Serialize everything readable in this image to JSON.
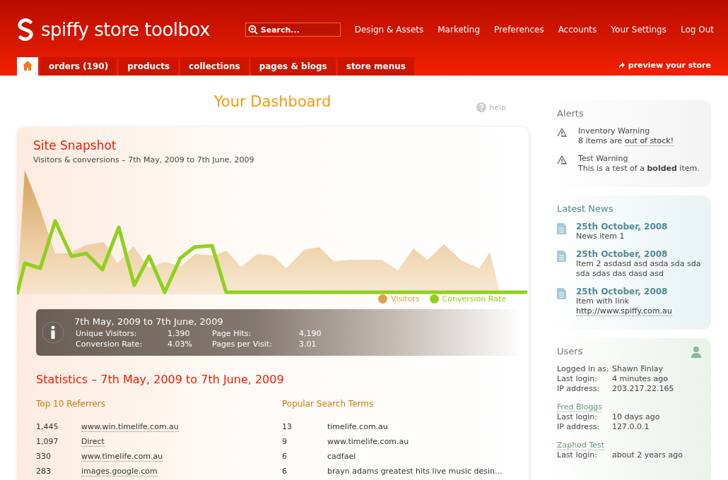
{
  "header": {
    "logo_text": "spiffy store toolbox",
    "search": {
      "placeholder": "Search..."
    },
    "links": [
      "Design & Assets",
      "Marketing",
      "Preferences",
      "Accounts",
      "Your Settings",
      "Log Out"
    ]
  },
  "tabs": [
    {
      "kind": "home",
      "selected": true
    },
    {
      "kind": "text",
      "label": "orders (190)",
      "selected": false
    },
    {
      "kind": "text",
      "label": "products",
      "selected": false
    },
    {
      "kind": "text",
      "label": "collections",
      "selected": false
    },
    {
      "kind": "text",
      "label": "pages & blogs",
      "selected": false
    },
    {
      "kind": "text",
      "label": "store menus",
      "selected": false
    }
  ],
  "preview_link": "preview your store",
  "page_title": "Your Dashboard",
  "help": "help",
  "snapshot": {
    "title": "Site Snapshot",
    "subtitle": "Visitors & conversions – 7th May, 2009 to 7th June, 2009",
    "legend": [
      {
        "label": "Visitors",
        "color": "#e0a048"
      },
      {
        "label": "Conversion Rate",
        "color": "#8fd11c"
      }
    ],
    "summary": {
      "title": "7th May, 2009 to 7th June, 2009",
      "stats": [
        {
          "label": "Unique Visitors:",
          "value": "1,390"
        },
        {
          "label": "Page Hits:",
          "value": "4,190"
        },
        {
          "label": "Conversion Rate:",
          "value": "4.03%"
        },
        {
          "label": "Pages per Visit:",
          "value": "3.01"
        }
      ]
    }
  },
  "statistics": {
    "title": "Statistics – 7th May, 2009 to 7th June, 2009",
    "referrers": {
      "title": "Top 10 Referrers",
      "rows": [
        {
          "count": "1,445",
          "site": "www.win.timelife.com.au"
        },
        {
          "count": "1,097",
          "site": "Direct"
        },
        {
          "count": "330",
          "site": "www.timelife.com.au"
        },
        {
          "count": "283",
          "site": "images.google.com"
        }
      ]
    },
    "search_terms": {
      "title": "Popular Search Terms",
      "rows": [
        {
          "count": "13",
          "term": "timelife.com.au"
        },
        {
          "count": "9",
          "term": "www.timelife.com.au"
        },
        {
          "count": "6",
          "term": "cadfael"
        },
        {
          "count": "6",
          "term": "brayn adams greatest hits live music desin..."
        }
      ]
    }
  },
  "alerts": {
    "title": "Alerts",
    "items": [
      {
        "title": "Inventory Warning",
        "text": "8 items are ",
        "link": "out of stock!"
      },
      {
        "title": "Test Warning",
        "text": "This is a test of a **bolded** item."
      }
    ]
  },
  "news": {
    "title": "Latest News",
    "items": [
      {
        "date": "25th October, 2008",
        "text": "News item 1"
      },
      {
        "date": "25th October, 2008",
        "text": "Item 2 asdasd asd asda sda sda sda sdas das dasd asd"
      },
      {
        "date": "25th October, 2008",
        "text": "Item with link",
        "link": "http://www.spiffy.com.au"
      }
    ]
  },
  "users": {
    "title": "Users",
    "entries": [
      {
        "rows": [
          {
            "label": "Logged in as:",
            "value": "Shawn Finlay"
          },
          {
            "label": "Last login:",
            "value": "4 minutes ago"
          },
          {
            "label": "IP address:",
            "value": "203.217.22.165"
          }
        ]
      },
      {
        "name": "Fred Bloggs",
        "rows": [
          {
            "label": "Last login:",
            "value": "10 days ago"
          },
          {
            "label": "IP address:",
            "value": "127.0.0.1"
          }
        ]
      },
      {
        "name": "Zaphod Test",
        "rows": [
          {
            "label": "Last login:",
            "value": "about 2 years ago"
          }
        ]
      }
    ]
  }
}
